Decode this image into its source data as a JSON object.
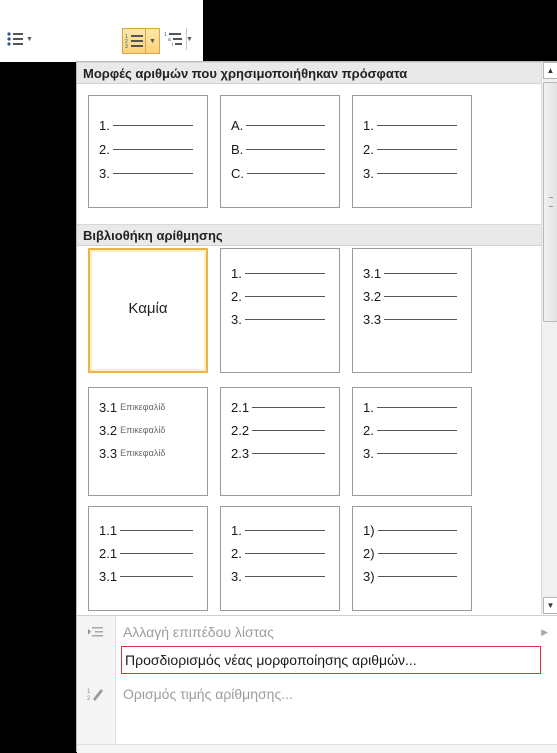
{
  "toolbar": {
    "bullets_icon": "bullet-list-icon",
    "numbering_icon": "numbered-list-icon",
    "multilevel_icon": "multilevel-list-icon"
  },
  "recent": {
    "title": "Μορφές αριθμών που χρησιμοποιήθηκαν πρόσφατα",
    "tiles": [
      {
        "labels": [
          "1.",
          "2.",
          "3."
        ]
      },
      {
        "labels": [
          "A.",
          "B.",
          "C."
        ]
      },
      {
        "labels": [
          "1.",
          "2.",
          "3."
        ]
      }
    ]
  },
  "library": {
    "title": "Βιβλιοθήκη αρίθμησης",
    "none_label": "Καμία",
    "tiles": [
      {
        "labels": [
          "1.",
          "2.",
          "3."
        ]
      },
      {
        "labels": [
          "3.1",
          "3.2",
          "3.3"
        ]
      },
      {
        "labels": [
          "3.1",
          "3.2",
          "3.3"
        ],
        "suffix": "Επικεφαλίδ"
      },
      {
        "labels": [
          "2.1",
          "2.2",
          "2.3"
        ]
      },
      {
        "labels": [
          "1.",
          "2.",
          "3."
        ]
      },
      {
        "labels": [
          "1.1",
          "2.1",
          "3.1"
        ]
      },
      {
        "labels": [
          "1.",
          "2.",
          "3."
        ]
      },
      {
        "labels": [
          "1)",
          "2)",
          "3)"
        ]
      }
    ]
  },
  "menu": {
    "change_level": "Αλλαγή επιπέδου λίστας",
    "change_level_key": "λ",
    "define_format": "Προσδιορισμός νέας μορφοποίησης αριθμών...",
    "define_format_key": "Π",
    "set_value": "Ορισμός τιμής αρίθμησης...",
    "set_value_key": "τ"
  },
  "colors": {
    "selected_border": "#e9b547",
    "highlight_border": "#d9343f"
  }
}
